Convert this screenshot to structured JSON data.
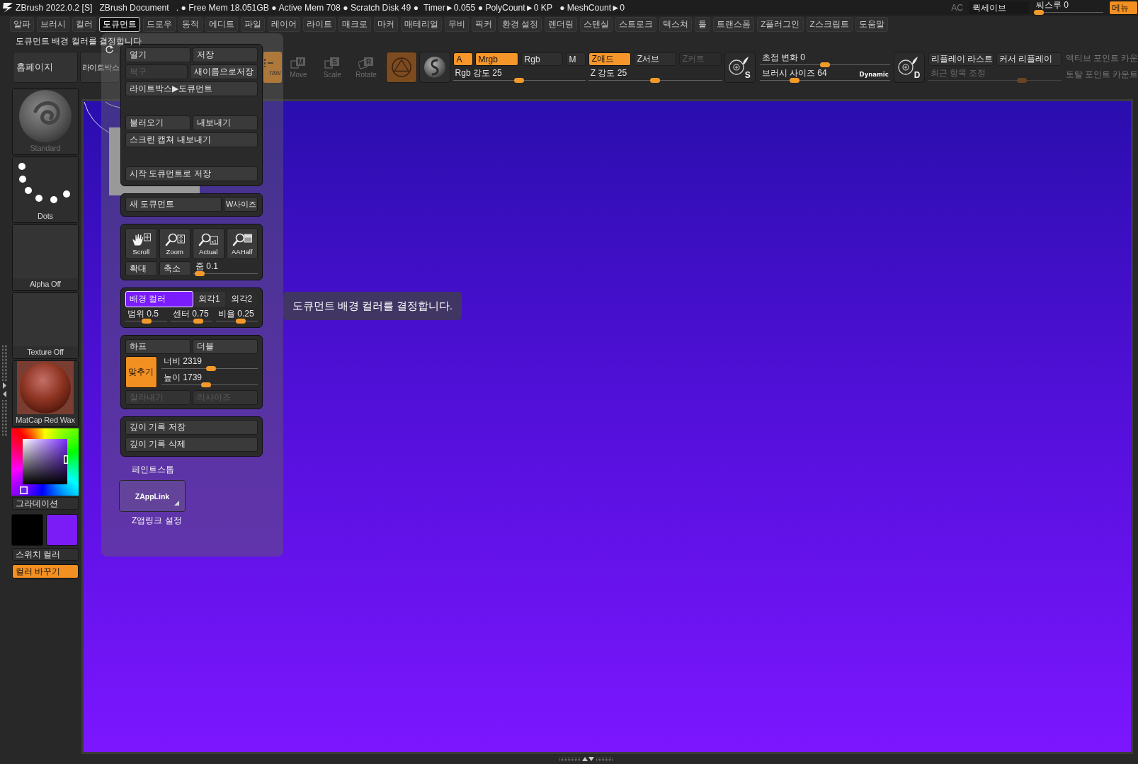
{
  "title_bar": {
    "app_name": "ZBrush 2022.0.2 [S]",
    "document": "ZBrush Document",
    "status": [
      ". ● Free Mem 18.051GB ● Active Mem 708 ● Scratch Disk 49 ●",
      "Timer►0.055 ● PolyCount►0 KP",
      "● MeshCount►0"
    ],
    "ac": "AC",
    "quicksave": "퀵세이브",
    "see_through": {
      "label": "씨스루 0",
      "level": 0
    },
    "menu_button": "메뉴"
  },
  "menu_bar": [
    {
      "label": "알파",
      "selected": false
    },
    {
      "label": "브러시",
      "selected": false
    },
    {
      "label": "컬러",
      "selected": false
    },
    {
      "label": "도큐먼트",
      "selected": true
    },
    {
      "label": "드로우",
      "selected": false
    },
    {
      "label": "동적",
      "selected": false
    },
    {
      "label": "에디트",
      "selected": false
    },
    {
      "label": "파일",
      "selected": false
    },
    {
      "label": "레이어",
      "selected": false
    },
    {
      "label": "라이트",
      "selected": false
    },
    {
      "label": "매크로",
      "selected": false
    },
    {
      "label": "마커",
      "selected": false
    },
    {
      "label": "매테리얼",
      "selected": false
    },
    {
      "label": "무비",
      "selected": false
    },
    {
      "label": "픽커",
      "selected": false
    },
    {
      "label": "환경 설정",
      "selected": false
    },
    {
      "label": "렌더링",
      "selected": false
    },
    {
      "label": "스텐실",
      "selected": false
    },
    {
      "label": "스트로크",
      "selected": false
    },
    {
      "label": "텍스쳐",
      "selected": false
    },
    {
      "label": "툴",
      "selected": false
    },
    {
      "label": "트랜스폼",
      "selected": false
    },
    {
      "label": "Z플러그인",
      "selected": false
    },
    {
      "label": "Z스크립트",
      "selected": false
    },
    {
      "label": "도움말",
      "selected": false
    }
  ],
  "hint": "도큐먼트 배경 컬러를 결정합니다",
  "toolbar": {
    "nav_buttons": [
      "홈페이지",
      "라이트박스"
    ],
    "modes": [
      {
        "kind": "draw",
        "label": "raw",
        "selected": true
      },
      {
        "kind": "move",
        "label": "Move",
        "letter": "M",
        "selected": false
      },
      {
        "kind": "scale",
        "label": "Scale",
        "letter": "S",
        "selected": false
      },
      {
        "kind": "rotate",
        "label": "Rotate",
        "letter": "R",
        "selected": false
      }
    ],
    "shape_buttons": [
      {
        "kind": "mesh",
        "selected": true
      },
      {
        "kind": "sphere",
        "selected": false
      }
    ],
    "channels": [
      {
        "label": "A",
        "selected": true
      },
      {
        "label": "Mrgb",
        "selected": true
      },
      {
        "label": "Rgb",
        "selected": false
      },
      {
        "label": "M",
        "selected": false
      }
    ],
    "rgb_intensity": {
      "label": "Rgb 강도 25",
      "level": 0.5
    },
    "z_modes": [
      {
        "label": "Z애드",
        "selected": true,
        "disabled": false
      },
      {
        "label": "Z서브",
        "selected": false,
        "disabled": false
      },
      {
        "label": "Z커트",
        "selected": false,
        "disabled": true
      }
    ],
    "z_intensity": {
      "label": "Z 강도 25",
      "level": 0.5
    },
    "stroke_picker": "S",
    "focal_shift": {
      "label": "초점 변화 0",
      "level": 0.5
    },
    "draw_size": {
      "label": "브러시 사이즈 64",
      "level": 0.25,
      "tag": "Dynamic"
    },
    "dynamics_picker": "D",
    "replay": [
      "리플레이 라스트",
      "커서 리플레이"
    ],
    "recent_adjust": {
      "label": "최근 항목 조정",
      "level": 0.72,
      "disabled": true
    },
    "point_counts": [
      "액티브 포인트 카운",
      "토탈 포인트 카운트"
    ]
  },
  "sidebar": {
    "tiles": [
      {
        "kind": "brush",
        "label": "Standard",
        "disabled": true
      },
      {
        "kind": "stroke",
        "label": "Dots",
        "disabled": false
      },
      {
        "kind": "alpha",
        "label": "Alpha Off",
        "disabled": false
      },
      {
        "kind": "texture",
        "label": "Texture Off",
        "disabled": false
      },
      {
        "kind": "material",
        "label": "MatCap Red Wax",
        "disabled": false
      }
    ],
    "gradient": {
      "label": "그라데이션",
      "selected": false
    },
    "swatches": [
      {
        "color": "#000000"
      },
      {
        "color": "#7b1cf6"
      }
    ],
    "switch_color": "스위치 컬러",
    "fill": {
      "label": "컬러 바꾸기",
      "selected": true
    }
  },
  "document_palette": {
    "groups": [
      {
        "kind": "file",
        "sections": [
          [
            [
              {
                "label": "열기",
                "disabled": false
              },
              {
                "label": "저장",
                "disabled": false
              }
            ],
            [
              {
                "label": "복구",
                "disabled": true
              },
              {
                "label": "새이름으로저장",
                "disabled": false
              }
            ],
            [
              {
                "label": "라이트박스▶도큐먼트",
                "disabled": false
              }
            ]
          ],
          [
            [
              {
                "label": "불러오기",
                "disabled": false
              },
              {
                "label": "내보내기",
                "disabled": false
              }
            ],
            [
              {
                "label": "스크린 캡쳐 내보내기",
                "disabled": false
              }
            ]
          ],
          [
            [
              {
                "label": "시작 도큐먼트로 저장",
                "disabled": false
              }
            ]
          ]
        ]
      },
      {
        "kind": "new",
        "buttons": [
          {
            "label": "새 도큐먼트",
            "disabled": false
          },
          {
            "label": "W사이즈",
            "disabled": false
          }
        ]
      },
      {
        "kind": "zoom",
        "tools": [
          {
            "kind": "scroll",
            "label": "Scroll"
          },
          {
            "kind": "zoom",
            "label": "Zoom"
          },
          {
            "kind": "actual",
            "label": "Actual",
            "icon_text": "x1"
          },
          {
            "kind": "aahalf",
            "label": "AAHalf"
          }
        ],
        "buttons": [
          "확대",
          "축소"
        ],
        "slider": {
          "label": "줌 0.1",
          "level": 0.03
        }
      },
      {
        "kind": "background",
        "options": [
          {
            "label": "배경 컬러",
            "selected": true,
            "color": "#7b1cff"
          },
          {
            "label": "외각1",
            "selected": false,
            "color": "#343434"
          },
          {
            "label": "외각2",
            "selected": false,
            "color": "#2c2c2c"
          }
        ],
        "sliders": [
          {
            "label": "범위 0.5",
            "level": 0.51
          },
          {
            "label": "센터 0.75",
            "level": 0.72
          },
          {
            "label": "비율 0.25",
            "level": 0.62
          }
        ]
      },
      {
        "kind": "size",
        "buttons": [
          {
            "label": "하프",
            "disabled": false
          },
          {
            "label": "더블",
            "disabled": false
          }
        ],
        "fit": {
          "label": "맞추기",
          "selected": true
        },
        "sliders": [
          {
            "label": "너비 2319",
            "level": 0.52
          },
          {
            "label": "높이 1739",
            "level": 0.46
          }
        ],
        "actions": [
          {
            "label": "잘라내기",
            "disabled": true
          },
          {
            "label": "리사이즈",
            "disabled": true
          }
        ]
      },
      {
        "kind": "file",
        "sections": [
          [
            [
              {
                "label": "깊이 기록 저장",
                "disabled": false
              }
            ],
            [
              {
                "label": "깊이 기록 삭제",
                "disabled": false
              }
            ]
          ]
        ]
      }
    ],
    "paint_stop": "페인트스톱",
    "zapplink": "ZAppLink",
    "zapplink_settings": "Z앱링크 설정"
  },
  "tooltip": "도큐먼트 배경 컬러를 결정합니다."
}
